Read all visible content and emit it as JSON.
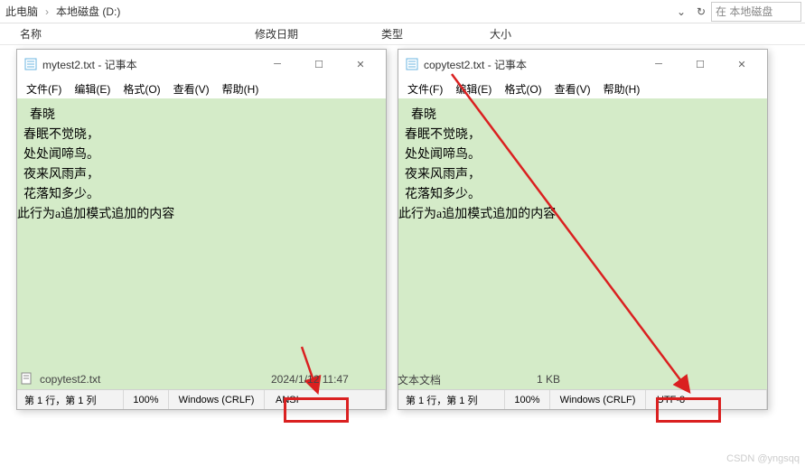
{
  "explorer": {
    "crumb1": "此电脑",
    "crumb2": "本地磁盘 (D:)",
    "search_placeholder": "在 本地磁盘"
  },
  "columns": {
    "name": "名称",
    "date": "修改日期",
    "type": "类型",
    "size": "大小"
  },
  "notepad_left": {
    "title": "mytest2.txt - 记事本",
    "menus": {
      "file": "文件(F)",
      "edit": "编辑(E)",
      "format": "格式(O)",
      "view": "查看(V)",
      "help": "帮助(H)"
    },
    "content": "    春晓\n  春眠不觉晓，\n  处处闻啼鸟。\n  夜来风雨声，\n  花落知多少。\n此行为a追加模式追加的内容",
    "status": {
      "pos": "第 1 行，第 1 列",
      "zoom": "100%",
      "eol": "Windows (CRLF)",
      "enc": "ANSI"
    }
  },
  "notepad_right": {
    "title": "copytest2.txt - 记事本",
    "menus": {
      "file": "文件(F)",
      "edit": "编辑(E)",
      "format": "格式(O)",
      "view": "查看(V)",
      "help": "帮助(H)"
    },
    "content": "    春晓\n  春眠不觉晓，\n  处处闻啼鸟。\n  夜来风雨声，\n  花落知多少。\n此行为a追加模式追加的内容",
    "status": {
      "pos": "第 1 行，第 1 列",
      "zoom": "100%",
      "eol": "Windows (CRLF)",
      "enc": "UTF-8"
    }
  },
  "file_row": {
    "name": "copytest2.txt",
    "date": "2024/1/12 11:47",
    "type": "文本文档",
    "size": "1 KB"
  },
  "watermark": "CSDN @yngsqq"
}
